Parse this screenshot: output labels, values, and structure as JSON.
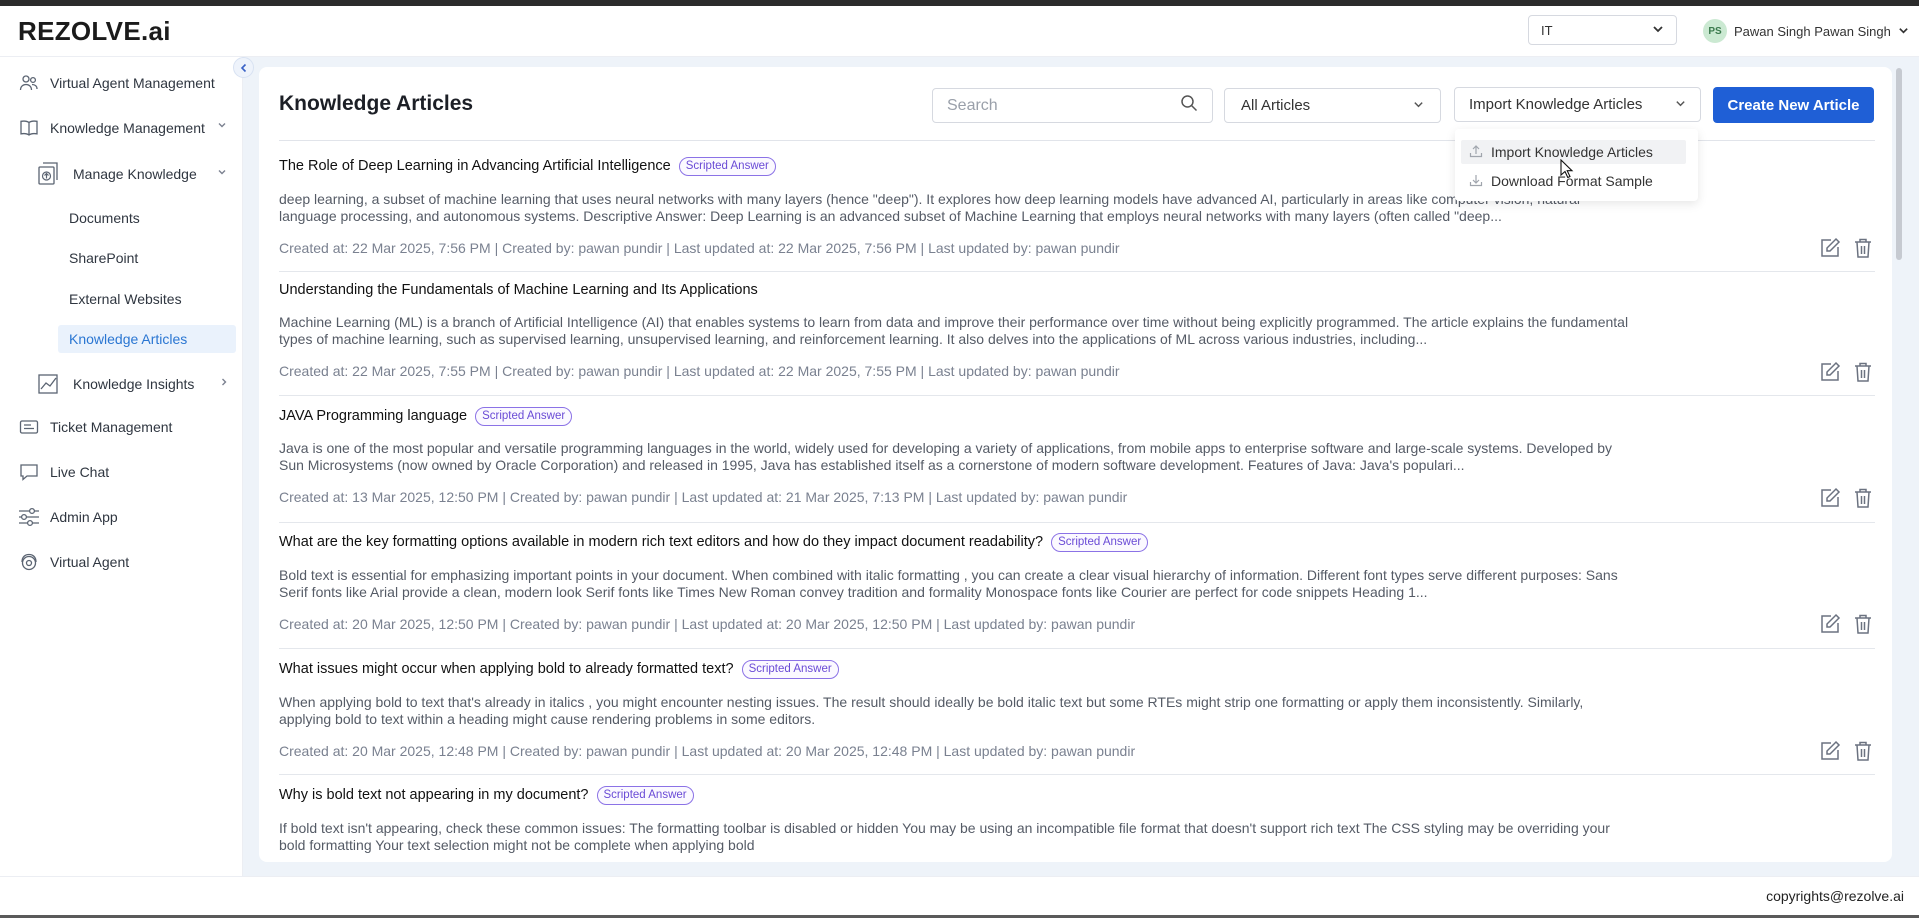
{
  "app": {
    "logo": "REZOLVE.ai"
  },
  "header": {
    "tenant": "IT",
    "user_initials": "PS",
    "user_name": "Pawan Singh Pawan Singh"
  },
  "sidebar": {
    "items": [
      {
        "label": "Virtual Agent Management",
        "icon": "users-icon"
      },
      {
        "label": "Knowledge Management",
        "icon": "book-icon"
      },
      {
        "label": "Manage Knowledge",
        "icon": "upload-doc-icon"
      },
      {
        "label": "Knowledge Insights",
        "icon": "chart-icon"
      },
      {
        "label": "Ticket Management",
        "icon": "ticket-icon"
      },
      {
        "label": "Live Chat",
        "icon": "chat-icon"
      },
      {
        "label": "Admin App",
        "icon": "sliders-icon"
      },
      {
        "label": "Virtual Agent",
        "icon": "agent-icon"
      }
    ],
    "subitems": [
      "Documents",
      "SharePoint",
      "External Websites",
      "Knowledge Articles"
    ]
  },
  "main": {
    "title": "Knowledge Articles",
    "search_placeholder": "Search",
    "filter_value": "All Articles",
    "import_label": "Import Knowledge Articles",
    "create_label": "Create New Article",
    "dropdown": [
      {
        "label": "Import Knowledge Articles",
        "icon": "upload-icon"
      },
      {
        "label": "Download Format Sample",
        "icon": "download-icon"
      }
    ]
  },
  "articles": [
    {
      "title": "The Role of Deep Learning in Advancing Artificial Intelligence",
      "badge": "Scripted Answer",
      "description": "deep learning, a subset of machine learning that uses neural networks with many layers (hence \"deep\"). It explores how deep learning models have advanced AI, particularly in areas like computer vision, natural language processing, and autonomous systems. Descriptive Answer: Deep Learning is an advanced subset of Machine Learning that employs neural networks with many layers (often called \"deep...",
      "meta": "Created at: 22 Mar 2025, 7:56 PM | Created by: pawan pundir | Last updated at: 22 Mar 2025, 7:56 PM | Last updated by: pawan pundir"
    },
    {
      "title": "Understanding the Fundamentals of Machine Learning and Its Applications",
      "badge": "",
      "description": "Machine Learning (ML) is a branch of Artificial Intelligence (AI) that enables systems to learn from data and improve their performance over time without being explicitly programmed. The article explains the fundamental types of machine learning, such as supervised learning, unsupervised learning, and reinforcement learning. It also delves into the applications of ML across various industries, including...",
      "meta": "Created at: 22 Mar 2025, 7:55 PM | Created by: pawan pundir | Last updated at: 22 Mar 2025, 7:55 PM | Last updated by: pawan pundir"
    },
    {
      "title": "JAVA Programming language",
      "badge": "Scripted Answer",
      "description": "Java is one of the most popular and versatile programming languages in the world, widely used for developing a variety of applications, from mobile apps to enterprise software and large-scale systems. Developed by Sun Microsystems (now owned by Oracle Corporation) and released in 1995, Java has established itself as a cornerstone of modern software development. Features of Java: Java's populari...",
      "meta": "Created at: 13 Mar 2025, 12:50 PM | Created by: pawan pundir | Last updated at: 21 Mar 2025, 7:13 PM | Last updated by: pawan pundir"
    },
    {
      "title": "What are the key formatting options available in modern rich text editors and how do they impact document readability?",
      "badge": "Scripted Answer",
      "description": "Bold text is essential for emphasizing important points in your document. When combined with italic formatting , you can create a clear visual hierarchy of information. Different font types serve different purposes: Sans Serif fonts like Arial provide a clean, modern look Serif fonts like Times New Roman convey tradition and formality Monospace fonts like Courier are perfect for code snippets Heading 1...",
      "meta": "Created at: 20 Mar 2025, 12:50 PM | Created by: pawan pundir | Last updated at: 20 Mar 2025, 12:50 PM | Last updated by: pawan pundir"
    },
    {
      "title": "What issues might occur when applying bold to already formatted text?",
      "badge": "Scripted Answer",
      "description": "When applying bold to text that's already in italics , you might encounter nesting issues. The result should ideally be bold italic text but some RTEs might strip one formatting or apply them inconsistently. Similarly, applying bold to text within a heading might cause rendering problems in some editors.",
      "meta": "Created at: 20 Mar 2025, 12:48 PM | Created by: pawan pundir | Last updated at: 20 Mar 2025, 12:48 PM | Last updated by: pawan pundir"
    },
    {
      "title": "Why is bold text not appearing in my document?",
      "badge": "Scripted Answer",
      "description": "If bold text isn't appearing, check these common issues: The formatting toolbar is disabled or hidden You may be using an incompatible file format that doesn't support rich text The CSS styling may be overriding your bold formatting Your text selection might not be complete when applying bold",
      "meta": ""
    }
  ],
  "footer": {
    "text": "copyrights@rezolve.ai"
  }
}
